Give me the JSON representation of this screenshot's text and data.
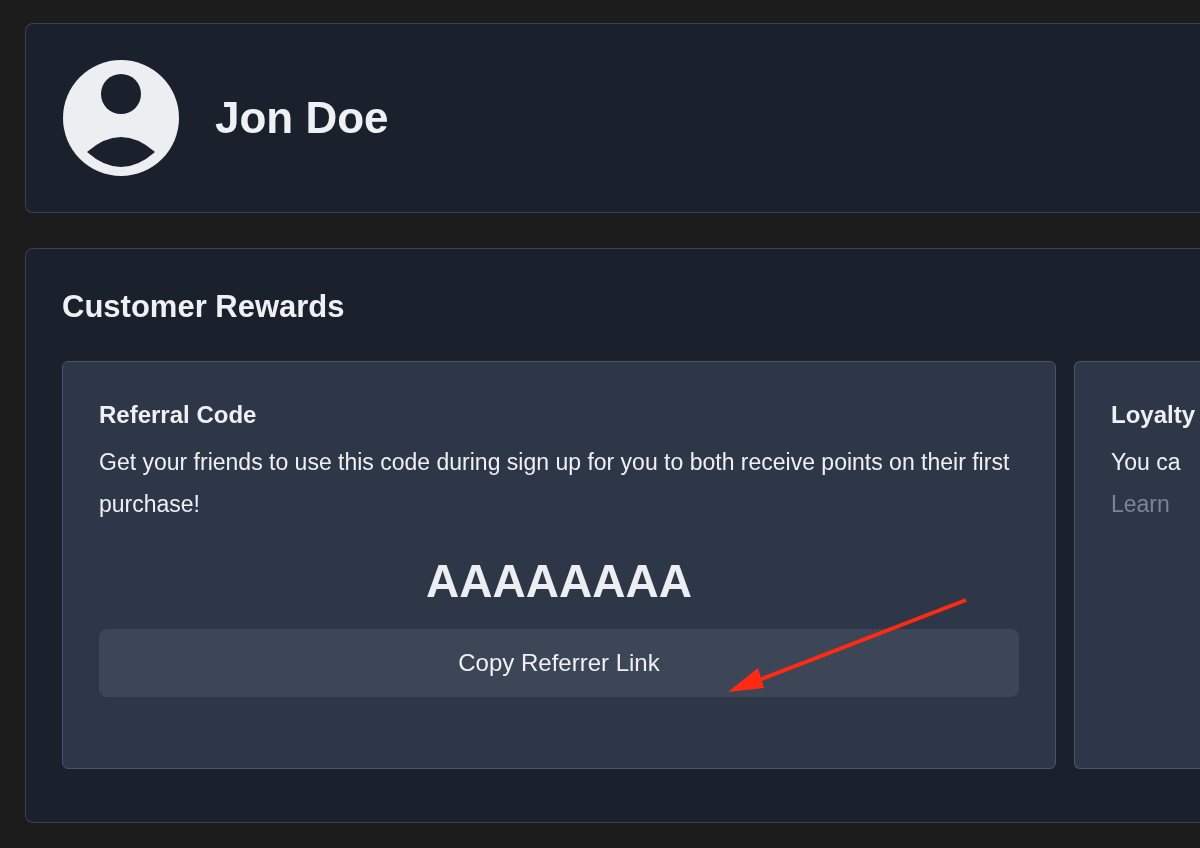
{
  "profile": {
    "name": "Jon Doe"
  },
  "rewards": {
    "title": "Customer Rewards",
    "referral": {
      "title": "Referral Code",
      "description": "Get your friends to use this code during sign up for you to both receive points on their first purchase!",
      "code": "AAAAAAAA",
      "button": "Copy Referrer Link"
    },
    "loyalty": {
      "title": "Loyalty",
      "description": "You ca",
      "link": "Learn"
    }
  }
}
